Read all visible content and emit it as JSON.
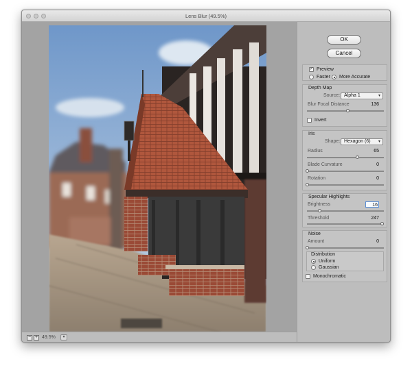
{
  "window": {
    "title": "Lens Blur (49.5%)"
  },
  "status": {
    "zoom_out": "−",
    "zoom_in": "+",
    "zoom": "49.5%",
    "zoom_menu": "▾"
  },
  "buttons": {
    "ok": "OK",
    "cancel": "Cancel"
  },
  "preview": {
    "preview_label": "Preview",
    "preview_checked": true,
    "faster_label": "Faster",
    "accurate_label": "More Accurate",
    "mode": "More Accurate"
  },
  "depth_map": {
    "title": "Depth Map",
    "source_label": "Source:",
    "source_value": "Alpha 1",
    "focal_label": "Blur Focal Distance",
    "focal_value": "136",
    "focal_level": 0.53,
    "invert_label": "Invert",
    "invert_checked": false
  },
  "iris": {
    "title": "Iris",
    "shape_label": "Shape:",
    "shape_value": "Hexagon (6)",
    "radius_label": "Radius",
    "radius_value": "65",
    "radius_level": 0.65,
    "curvature_label": "Blade Curvature",
    "curvature_value": "0",
    "curvature_level": 0,
    "rotation_label": "Rotation",
    "rotation_value": "0",
    "rotation_level": 0
  },
  "specular": {
    "title": "Specular Highlights",
    "brightness_label": "Brightness",
    "brightness_value": "16",
    "brightness_level": 0.16,
    "threshold_label": "Threshold",
    "threshold_value": "247",
    "threshold_level": 0.97
  },
  "noise": {
    "title": "Noise",
    "amount_label": "Amount",
    "amount_value": "0",
    "amount_level": 0,
    "distribution_title": "Distribution",
    "uniform_label": "Uniform",
    "gaussian_label": "Gaussian",
    "distribution": "Uniform",
    "mono_label": "Monochromatic",
    "mono_checked": false
  }
}
